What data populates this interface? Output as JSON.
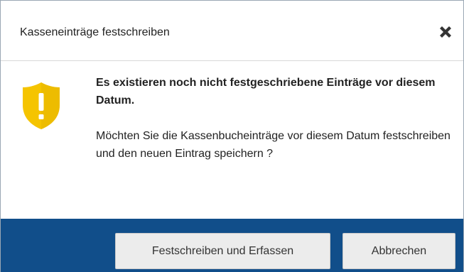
{
  "dialog": {
    "title": "Kasseneinträge festschreiben",
    "close_icon": "close-icon",
    "warning_icon": "shield-exclamation-icon",
    "message_strong": "Es existieren noch nicht festgeschriebene Einträge vor diesem Datum.",
    "message": "Möchten Sie die Kassenbucheinträge vor diesem Datum festschreiben und den neuen Eintrag speichern ?",
    "buttons": {
      "confirm_label": "Festschreiben und Erfassen",
      "cancel_label": "Abbrechen"
    }
  },
  "colors": {
    "footer": "#114e8a",
    "warning": "#f5c400",
    "button_bg": "#ececec"
  }
}
